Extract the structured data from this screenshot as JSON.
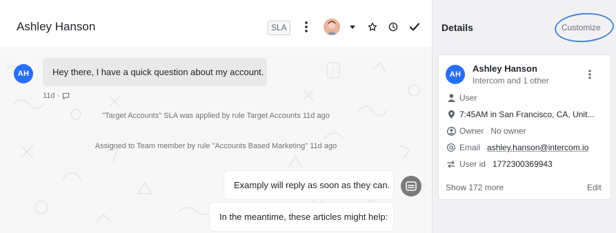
{
  "conversation": {
    "title": "Ashley Hanson",
    "sla_badge": "SLA",
    "messages": [
      {
        "avatar_initials": "AH",
        "text": "Hey there, I have a quick question about my account.",
        "meta": "11d ·"
      }
    ],
    "events": [
      "\"Target Accounts\" SLA was applied by rule Target Accounts 11d ago",
      "Assigned to Team member by rule \"Accounts Based Marketing\" 11d ago"
    ],
    "bot_replies": [
      "Examply will reply as soon as they can.",
      "In the meantime, these articles might help:"
    ],
    "header_icons": [
      "more-vertical-icon",
      "assignee-avatar",
      "chevron-down-icon",
      "star-icon",
      "clock-icon",
      "check-icon"
    ]
  },
  "details": {
    "title": "Details",
    "customize_label": "Customize",
    "contact": {
      "initials": "AH",
      "name": "Ashley Hanson",
      "subtitle": "Intercom and 1 other",
      "role": "User",
      "location": "7:45AM in San Francisco, CA, Unit...",
      "owner_label": "Owner",
      "owner_value": "No owner",
      "email_label": "Email",
      "email_value": "ashley.hanson@intercom.io",
      "userid_label": "User id",
      "userid_value": "1772300369943"
    },
    "show_more_label": "Show 172 more",
    "edit_label": "Edit"
  },
  "colors": {
    "avatar_blue": "#286efa",
    "annotation_ring": "#4a86d8",
    "details_bg": "#f1f1f3",
    "inbound_bubble": "#e9e9e9"
  }
}
